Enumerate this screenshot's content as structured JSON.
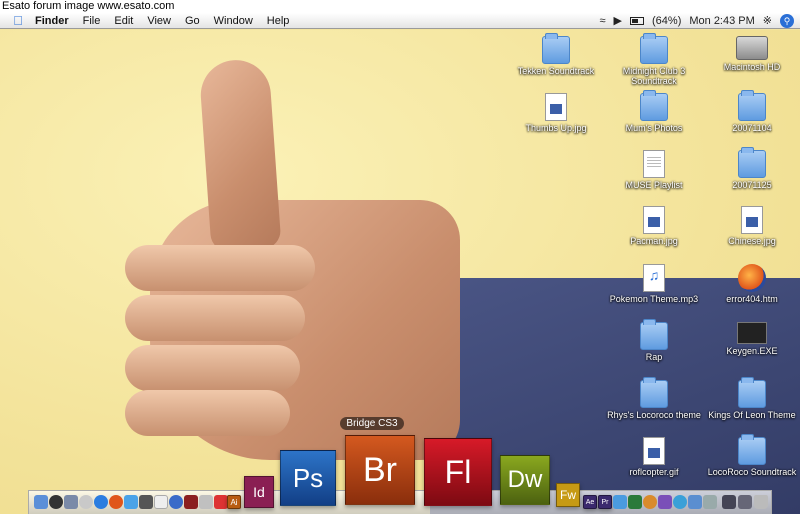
{
  "watermark": "Esato forum image www.esato.com",
  "menubar": {
    "apple_icon": "apple-icon",
    "items": [
      "Finder",
      "File",
      "Edit",
      "View",
      "Go",
      "Window",
      "Help"
    ],
    "status": {
      "battery": "(64%)",
      "battery_level": 0.64,
      "clock": "Mon 2:43 PM"
    }
  },
  "desktop_icons": [
    {
      "label": "Tekken Soundtrack",
      "kind": "folder"
    },
    {
      "label": "Midnight Club 3 Soundtrack",
      "kind": "folder"
    },
    {
      "label": "Macintosh HD",
      "kind": "hd"
    },
    {
      "label": "Thumbs Up.jpg",
      "kind": "jpeg"
    },
    {
      "label": "Mum's Photos",
      "kind": "folder"
    },
    {
      "label": "20071104",
      "kind": "folder"
    },
    {
      "label": "MUSE Playlist",
      "kind": "doc"
    },
    {
      "label": "20071125",
      "kind": "folder"
    },
    {
      "label": "Pacman.jpg",
      "kind": "jpeg"
    },
    {
      "label": "Chinese.jpg",
      "kind": "jpeg"
    },
    {
      "label": "Pokemon Theme.mp3",
      "kind": "mp3"
    },
    {
      "label": "error404.htm",
      "kind": "ff"
    },
    {
      "label": "Rap",
      "kind": "folder"
    },
    {
      "label": "Keygen.EXE",
      "kind": "exe"
    },
    {
      "label": "Rhys's Locoroco theme",
      "kind": "folder"
    },
    {
      "label": "Kings Of Leon Theme",
      "kind": "folder"
    },
    {
      "label": "roflcopter.gif",
      "kind": "jpeg"
    },
    {
      "label": "LocoRoco Soundtrack",
      "kind": "folder"
    }
  ],
  "dock": {
    "hover_label": "Bridge CS3",
    "apps": [
      {
        "label": "Id",
        "color": "#8a1f53"
      },
      {
        "label": "Ps",
        "color": "#1d5fb0"
      },
      {
        "label": "Br",
        "color": "#b4441a"
      },
      {
        "label": "Fl",
        "color": "#b3111e"
      },
      {
        "label": "Dw",
        "color": "#6d8a17"
      },
      {
        "label": "Fw",
        "color": "#c69a14"
      }
    ],
    "mini_labels": [
      "Ai",
      "Ae",
      "Pr"
    ]
  }
}
